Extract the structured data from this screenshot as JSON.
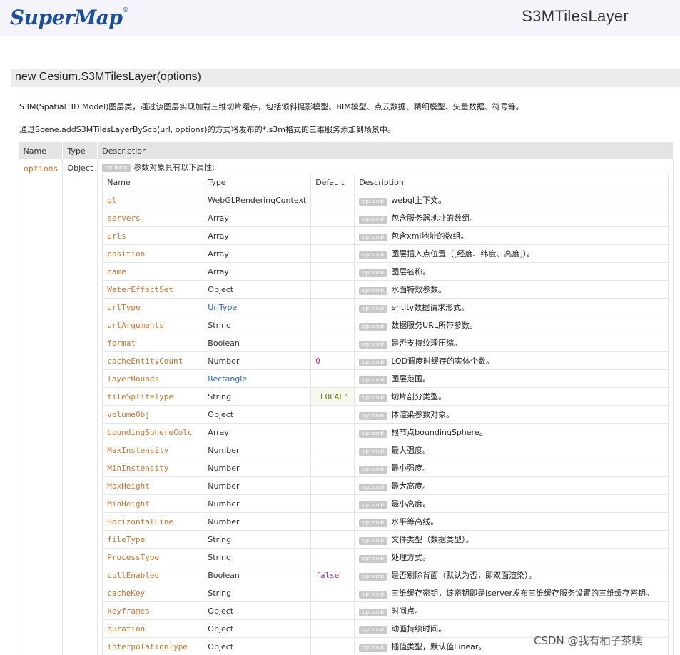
{
  "header": {
    "logo": "SuperMap",
    "logo_mark": "®",
    "page_title": "S3MTilesLayer"
  },
  "signature": "new Cesium.S3MTilesLayer(options)",
  "description": [
    "S3M(Spatial 3D Model)图层类，通过该图层实现加载三维切片缓存，包括倾斜摄影模型、BIM模型、点云数据、精细模型、矢量数据、符号等。",
    "通过Scene.addS3MTilesLayerByScp(url, options)的方式将发布的*.s3m格式的三维服务添加到场景中。"
  ],
  "params_table": {
    "headers": [
      "Name",
      "Type",
      "Description"
    ],
    "row": {
      "name": "options",
      "type": "Object",
      "badge": "optional",
      "description": "参数对象具有以下属性:"
    }
  },
  "properties_table": {
    "headers": [
      "Name",
      "Type",
      "Default",
      "Description"
    ],
    "badge": "optional",
    "rows": [
      {
        "name": "gl",
        "type": "WebGLRenderingContext",
        "default": "",
        "description": "webgl上下文。"
      },
      {
        "name": "servers",
        "type": "Array",
        "default": "",
        "description": "包含服务器地址的数组。"
      },
      {
        "name": "urls",
        "type": "Array",
        "default": "",
        "description": "包含xml地址的数组。"
      },
      {
        "name": "position",
        "type": "Array",
        "default": "",
        "description": "图层插入点位置（[经度、纬度、高度]）。"
      },
      {
        "name": "name",
        "type": "Array",
        "default": "",
        "description": "图层名称。"
      },
      {
        "name": "WaterEffectSet",
        "type": "Object",
        "default": "",
        "description": "水面特效参数。"
      },
      {
        "name": "urlType",
        "type": "UrlType",
        "default": "",
        "description": "entity数据请求形式。"
      },
      {
        "name": "urlArguments",
        "type": "String",
        "default": "",
        "description": "数据服务URL所带参数。"
      },
      {
        "name": "format",
        "type": "Boolean",
        "default": "",
        "description": "是否支持纹理压缩。"
      },
      {
        "name": "cacheEntityCount",
        "type": "Number",
        "default": "0",
        "description": "LOD调度时缓存的实体个数。"
      },
      {
        "name": "layerBounds",
        "type": "Rectangle",
        "default": "",
        "description": "图层范围。"
      },
      {
        "name": "tileSpliteType",
        "type": "String",
        "default": "'LOCAL'",
        "description": "切片剖分类型。"
      },
      {
        "name": "volumeObj",
        "type": "Object",
        "default": "",
        "description": "体渲染参数对象。"
      },
      {
        "name": "boundingSphereColc",
        "type": "Array",
        "default": "",
        "description": "根节点boundingSphere。"
      },
      {
        "name": "MaxInstensity",
        "type": "Number",
        "default": "",
        "description": "最大强度。"
      },
      {
        "name": "MinInstensity",
        "type": "Number",
        "default": "",
        "description": "最小强度。"
      },
      {
        "name": "MaxHeight",
        "type": "Number",
        "default": "",
        "description": "最大高度。"
      },
      {
        "name": "MinHeight",
        "type": "Number",
        "default": "",
        "description": "最小高度。"
      },
      {
        "name": "HorizontalLine",
        "type": "Number",
        "default": "",
        "description": "水平等高线。"
      },
      {
        "name": "fileType",
        "type": "String",
        "default": "",
        "description": "文件类型（数据类型）。"
      },
      {
        "name": "ProcessType",
        "type": "String",
        "default": "",
        "description": "处理方式。"
      },
      {
        "name": "cullEnabled",
        "type": "Boolean",
        "default": "false",
        "description": "是否剔除背面（默认为否，即双面渲染）。"
      },
      {
        "name": "cacheKey",
        "type": "String",
        "default": "",
        "description": "三维缓存密钥，该密钥即是iserver发布三维缓存服务设置的三维缓存密钥。"
      },
      {
        "name": "keyframes",
        "type": "Object",
        "default": "",
        "description": "时间点。"
      },
      {
        "name": "duration",
        "type": "Object",
        "default": "",
        "description": "动画持续时间。"
      },
      {
        "name": "interpolationType",
        "type": "Object",
        "default": "",
        "description": "插值类型，默认值Linear。"
      }
    ]
  },
  "watermark": "CSDN @我有柚子茶噢",
  "colors": {
    "param_name": "#c67630",
    "type_link": "#2a63b3",
    "default_number": "#b0306f",
    "default_string": "#6a8a2a",
    "badge_bg": "#c9c9c9",
    "header_bg": "#e4e4e4"
  }
}
